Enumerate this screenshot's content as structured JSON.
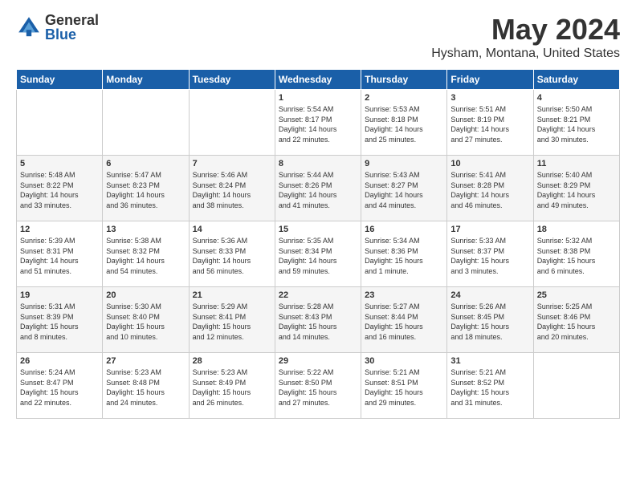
{
  "header": {
    "logo_general": "General",
    "logo_blue": "Blue",
    "month_title": "May 2024",
    "location": "Hysham, Montana, United States"
  },
  "days_of_week": [
    "Sunday",
    "Monday",
    "Tuesday",
    "Wednesday",
    "Thursday",
    "Friday",
    "Saturday"
  ],
  "weeks": [
    [
      {
        "day": "",
        "info": ""
      },
      {
        "day": "",
        "info": ""
      },
      {
        "day": "",
        "info": ""
      },
      {
        "day": "1",
        "info": "Sunrise: 5:54 AM\nSunset: 8:17 PM\nDaylight: 14 hours\nand 22 minutes."
      },
      {
        "day": "2",
        "info": "Sunrise: 5:53 AM\nSunset: 8:18 PM\nDaylight: 14 hours\nand 25 minutes."
      },
      {
        "day": "3",
        "info": "Sunrise: 5:51 AM\nSunset: 8:19 PM\nDaylight: 14 hours\nand 27 minutes."
      },
      {
        "day": "4",
        "info": "Sunrise: 5:50 AM\nSunset: 8:21 PM\nDaylight: 14 hours\nand 30 minutes."
      }
    ],
    [
      {
        "day": "5",
        "info": "Sunrise: 5:48 AM\nSunset: 8:22 PM\nDaylight: 14 hours\nand 33 minutes."
      },
      {
        "day": "6",
        "info": "Sunrise: 5:47 AM\nSunset: 8:23 PM\nDaylight: 14 hours\nand 36 minutes."
      },
      {
        "day": "7",
        "info": "Sunrise: 5:46 AM\nSunset: 8:24 PM\nDaylight: 14 hours\nand 38 minutes."
      },
      {
        "day": "8",
        "info": "Sunrise: 5:44 AM\nSunset: 8:26 PM\nDaylight: 14 hours\nand 41 minutes."
      },
      {
        "day": "9",
        "info": "Sunrise: 5:43 AM\nSunset: 8:27 PM\nDaylight: 14 hours\nand 44 minutes."
      },
      {
        "day": "10",
        "info": "Sunrise: 5:41 AM\nSunset: 8:28 PM\nDaylight: 14 hours\nand 46 minutes."
      },
      {
        "day": "11",
        "info": "Sunrise: 5:40 AM\nSunset: 8:29 PM\nDaylight: 14 hours\nand 49 minutes."
      }
    ],
    [
      {
        "day": "12",
        "info": "Sunrise: 5:39 AM\nSunset: 8:31 PM\nDaylight: 14 hours\nand 51 minutes."
      },
      {
        "day": "13",
        "info": "Sunrise: 5:38 AM\nSunset: 8:32 PM\nDaylight: 14 hours\nand 54 minutes."
      },
      {
        "day": "14",
        "info": "Sunrise: 5:36 AM\nSunset: 8:33 PM\nDaylight: 14 hours\nand 56 minutes."
      },
      {
        "day": "15",
        "info": "Sunrise: 5:35 AM\nSunset: 8:34 PM\nDaylight: 14 hours\nand 59 minutes."
      },
      {
        "day": "16",
        "info": "Sunrise: 5:34 AM\nSunset: 8:36 PM\nDaylight: 15 hours\nand 1 minute."
      },
      {
        "day": "17",
        "info": "Sunrise: 5:33 AM\nSunset: 8:37 PM\nDaylight: 15 hours\nand 3 minutes."
      },
      {
        "day": "18",
        "info": "Sunrise: 5:32 AM\nSunset: 8:38 PM\nDaylight: 15 hours\nand 6 minutes."
      }
    ],
    [
      {
        "day": "19",
        "info": "Sunrise: 5:31 AM\nSunset: 8:39 PM\nDaylight: 15 hours\nand 8 minutes."
      },
      {
        "day": "20",
        "info": "Sunrise: 5:30 AM\nSunset: 8:40 PM\nDaylight: 15 hours\nand 10 minutes."
      },
      {
        "day": "21",
        "info": "Sunrise: 5:29 AM\nSunset: 8:41 PM\nDaylight: 15 hours\nand 12 minutes."
      },
      {
        "day": "22",
        "info": "Sunrise: 5:28 AM\nSunset: 8:43 PM\nDaylight: 15 hours\nand 14 minutes."
      },
      {
        "day": "23",
        "info": "Sunrise: 5:27 AM\nSunset: 8:44 PM\nDaylight: 15 hours\nand 16 minutes."
      },
      {
        "day": "24",
        "info": "Sunrise: 5:26 AM\nSunset: 8:45 PM\nDaylight: 15 hours\nand 18 minutes."
      },
      {
        "day": "25",
        "info": "Sunrise: 5:25 AM\nSunset: 8:46 PM\nDaylight: 15 hours\nand 20 minutes."
      }
    ],
    [
      {
        "day": "26",
        "info": "Sunrise: 5:24 AM\nSunset: 8:47 PM\nDaylight: 15 hours\nand 22 minutes."
      },
      {
        "day": "27",
        "info": "Sunrise: 5:23 AM\nSunset: 8:48 PM\nDaylight: 15 hours\nand 24 minutes."
      },
      {
        "day": "28",
        "info": "Sunrise: 5:23 AM\nSunset: 8:49 PM\nDaylight: 15 hours\nand 26 minutes."
      },
      {
        "day": "29",
        "info": "Sunrise: 5:22 AM\nSunset: 8:50 PM\nDaylight: 15 hours\nand 27 minutes."
      },
      {
        "day": "30",
        "info": "Sunrise: 5:21 AM\nSunset: 8:51 PM\nDaylight: 15 hours\nand 29 minutes."
      },
      {
        "day": "31",
        "info": "Sunrise: 5:21 AM\nSunset: 8:52 PM\nDaylight: 15 hours\nand 31 minutes."
      },
      {
        "day": "",
        "info": ""
      }
    ]
  ]
}
